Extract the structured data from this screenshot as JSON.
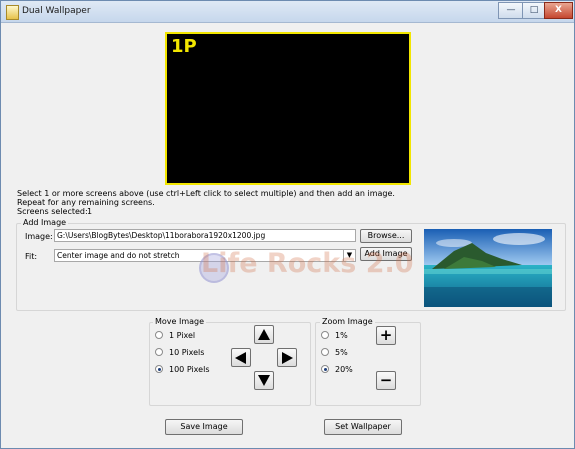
{
  "window": {
    "title": "Dual Wallpaper",
    "minimize": "—",
    "maximize": "□",
    "close": "X"
  },
  "preview": {
    "screen_label": "1P"
  },
  "instructions": {
    "line1": "Select 1 or more screens above (use ctrl+Left click to select multiple) and then add an image.",
    "line2": "Repeat for any remaining screens.",
    "screens_selected_label": "Screens selected:",
    "screens_selected_value": "1"
  },
  "add_image": {
    "group_label": "Add Image",
    "image_label": "Image:",
    "image_value": "G:\\Users\\BlogBytes\\Desktop\\11borabora1920x1200.jpg",
    "browse_button": "Browse...",
    "fit_label": "Fit:",
    "fit_value": "Center image and do not stretch",
    "add_image_button": "Add Image"
  },
  "watermark": "Life Rocks 2.0",
  "move_image": {
    "group_label": "Move Image",
    "options": [
      "1 Pixel",
      "10 Pixels",
      "100 Pixels"
    ],
    "selected": "100 Pixels"
  },
  "zoom_image": {
    "group_label": "Zoom Image",
    "options": [
      "1%",
      "5%",
      "20%"
    ],
    "selected": "20%",
    "zoom_in": "+",
    "zoom_out": "−"
  },
  "footer": {
    "save_image": "Save Image",
    "set_wallpaper": "Set Wallpaper"
  }
}
